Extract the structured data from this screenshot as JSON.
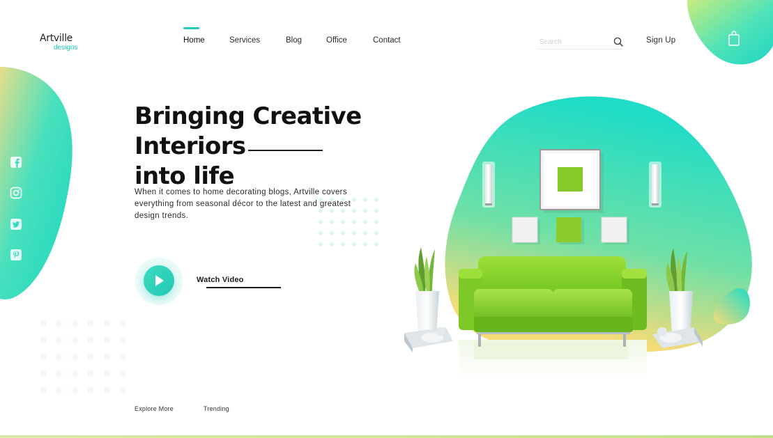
{
  "logo": {
    "name": "Artville",
    "tagline": "designs"
  },
  "nav": {
    "items": [
      {
        "label": "Home",
        "active": true
      },
      {
        "label": "Services"
      },
      {
        "label": "Blog"
      },
      {
        "label": "Office"
      },
      {
        "label": "Contact"
      }
    ]
  },
  "search": {
    "placeholder": "Search",
    "value": "",
    "icon": "search-icon"
  },
  "header": {
    "signup_label": "Sign Up",
    "cart_icon": "shopping-bag-icon"
  },
  "social": [
    "facebook-icon",
    "instagram-icon",
    "twitter-icon",
    "pinterest-icon"
  ],
  "hero": {
    "title_line1": "Bringing Creative Interiors",
    "title_line2": "into life",
    "description": "When it comes to home decorating blogs, Artville covers everything from seasonal décor to the latest and greatest design trends.",
    "watch_label": "Watch Video"
  },
  "footer": {
    "explore_label": "Explore More",
    "trending_label": "Trending"
  },
  "colors": {
    "accent": "#20cdb7",
    "gradient_start": "#1fdcc6",
    "gradient_end": "#f6db78",
    "sofa": "#86cf2c",
    "text": "#111111"
  }
}
